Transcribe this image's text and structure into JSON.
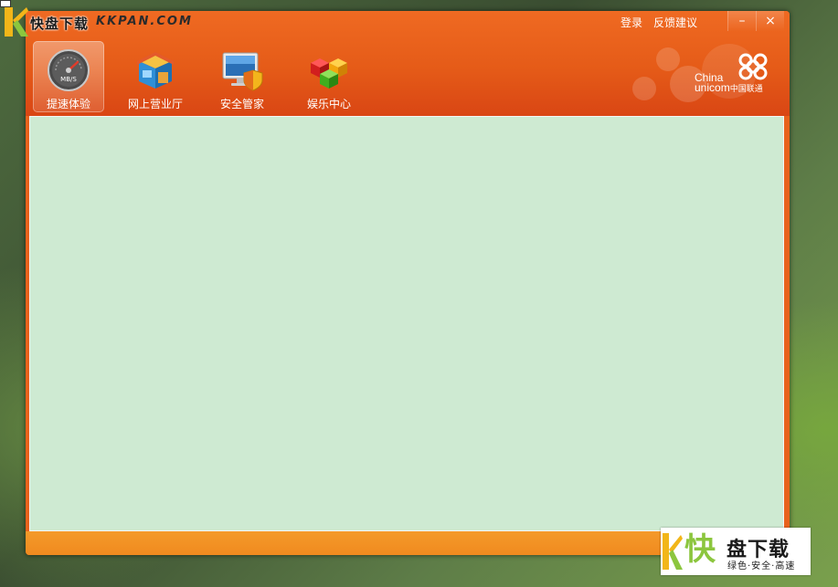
{
  "watermark_top": {
    "cn": "快盘下载",
    "en": "KKPAN.COM"
  },
  "header": {
    "links": [
      {
        "id": "login",
        "label": "登录"
      },
      {
        "id": "feedback",
        "label": "反馈建议"
      }
    ],
    "controls": {
      "minimize": "–",
      "close": "×"
    }
  },
  "nav": {
    "items": [
      {
        "label": "提速体验",
        "icon": "speedometer-icon",
        "active": true
      },
      {
        "label": "网上营业厅",
        "icon": "store-icon",
        "active": false
      },
      {
        "label": "安全管家",
        "icon": "monitor-shield-icon",
        "active": false
      },
      {
        "label": "娱乐中心",
        "icon": "cubes-icon",
        "active": false
      }
    ],
    "speedometer_text": "MB/S"
  },
  "brand": {
    "en1": "China",
    "en2": "unicom",
    "cn": "中国联通"
  },
  "colors": {
    "title_orange": "#e55b18",
    "status_orange": "#f49a2a",
    "content_green": "#ceead2",
    "watermark_green": "#8cc63e"
  },
  "watermark_bottom": {
    "kuai": "快",
    "title": "盘下载",
    "sub": "绿色·安全·高速"
  }
}
